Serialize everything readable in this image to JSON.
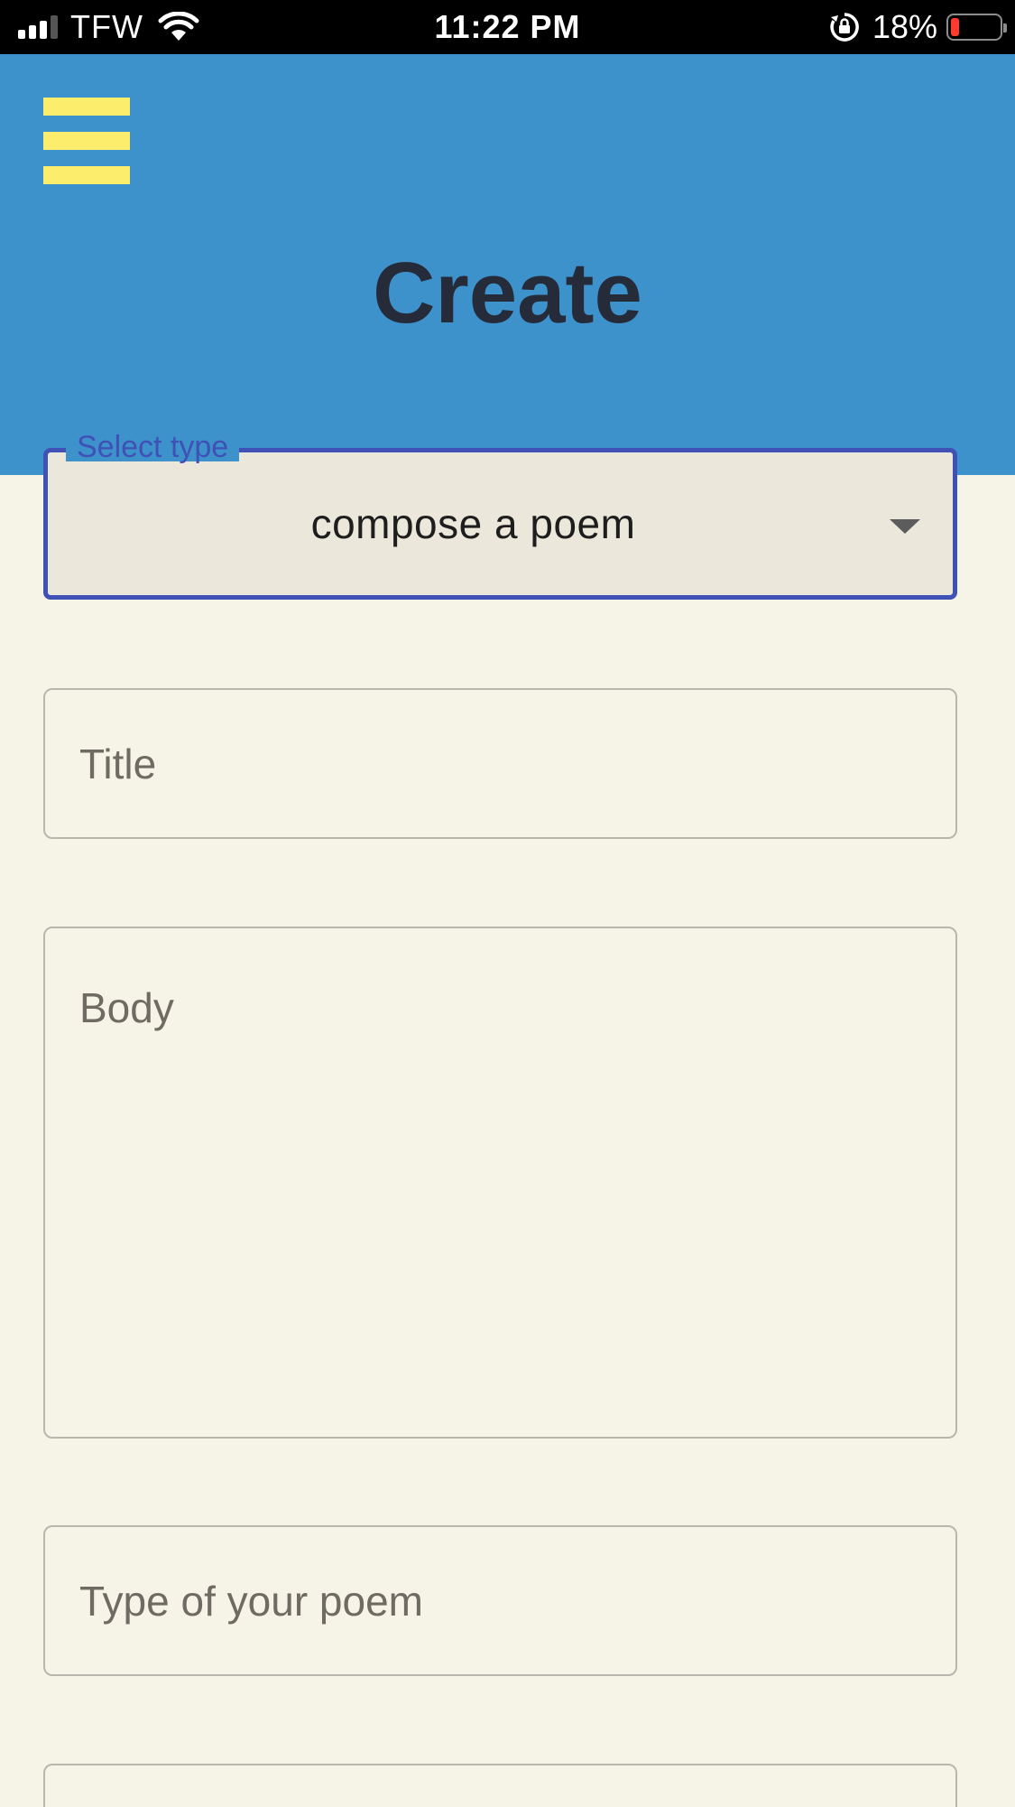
{
  "status_bar": {
    "carrier": "TFW",
    "time": "11:22 PM",
    "battery_percent": "18%",
    "battery_level": 0.18,
    "signal_bars_active": 3,
    "signal_bars_total": 4
  },
  "header": {
    "title": "Create",
    "background_color": "#3e92cc",
    "menu_icon": "hamburger-menu-icon",
    "menu_icon_color": "#fcee6c"
  },
  "form": {
    "type_select": {
      "label": "Select type",
      "value": "compose a poem",
      "accent_color": "#3f51b5"
    },
    "title_input": {
      "value": "",
      "placeholder": "Title"
    },
    "body_input": {
      "value": "",
      "placeholder": "Body"
    },
    "poem_type_input": {
      "value": "",
      "placeholder": "Type of your poem"
    },
    "next_input": {
      "value": "",
      "placeholder": ""
    }
  }
}
